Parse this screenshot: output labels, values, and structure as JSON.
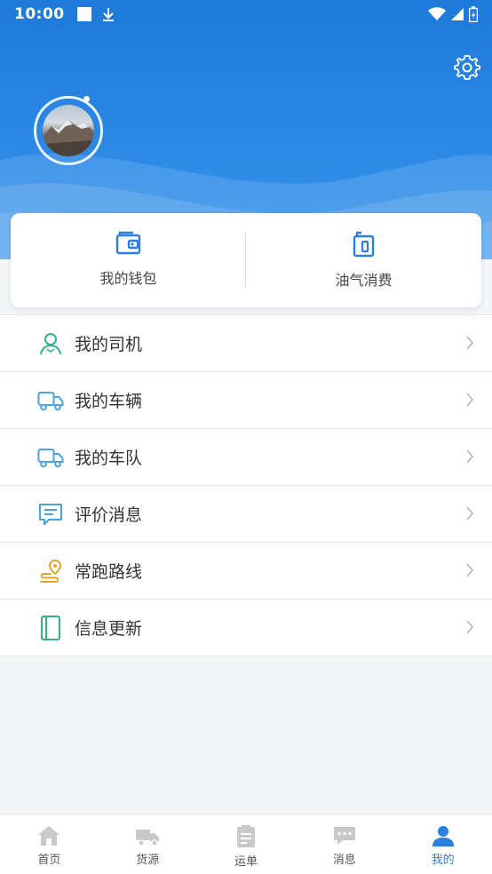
{
  "status_bar": {
    "time": "10:00"
  },
  "header": {
    "settings_icon": "gear-icon",
    "avatar": "profile-avatar"
  },
  "quick_actions": [
    {
      "label": "我的钱包",
      "icon": "wallet-icon"
    },
    {
      "label": "油气消费",
      "icon": "fuel-card-icon"
    }
  ],
  "menu": [
    {
      "label": "我的司机",
      "icon": "driver-icon"
    },
    {
      "label": "我的车辆",
      "icon": "truck-icon"
    },
    {
      "label": "我的车队",
      "icon": "fleet-icon"
    },
    {
      "label": "评价消息",
      "icon": "comment-icon"
    },
    {
      "label": "常跑路线",
      "icon": "route-icon"
    },
    {
      "label": "信息更新",
      "icon": "info-update-icon"
    }
  ],
  "tabbar": [
    {
      "label": "首页",
      "icon": "home-icon"
    },
    {
      "label": "货源",
      "icon": "cargo-truck-icon"
    },
    {
      "label": "运单",
      "icon": "waybill-icon"
    },
    {
      "label": "消息",
      "icon": "message-icon"
    },
    {
      "label": "我的",
      "icon": "user-icon",
      "active": true
    }
  ],
  "colors": {
    "primary": "#2b7fe0",
    "header": "#1e7ad8",
    "driver_icon": "#2fb38a",
    "truck_icon": "#4aa3df",
    "route_icon": "#e5a52a",
    "update_icon": "#2fb38a"
  }
}
